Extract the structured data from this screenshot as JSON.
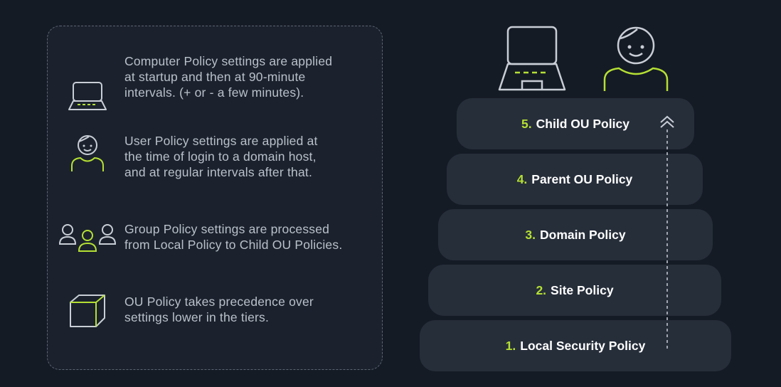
{
  "notes": [
    {
      "icon": "laptop-icon",
      "text_lines": [
        "Computer Policy settings are applied",
        "at startup and then at 90-minute",
        "intervals. (+ or - a few minutes)."
      ]
    },
    {
      "icon": "user-icon",
      "text_lines": [
        "User Policy settings are applied at",
        "the time of login to a domain host,",
        "and at regular intervals after that."
      ]
    },
    {
      "icon": "group-icon",
      "text_lines": [
        "Group Policy settings are processed",
        "from Local Policy to Child OU Policies."
      ]
    },
    {
      "icon": "cube-icon",
      "text_lines": [
        "OU Policy takes precedence over",
        "settings lower in the tiers."
      ]
    }
  ],
  "tiers": [
    {
      "number": "5.",
      "label": "Child OU Policy"
    },
    {
      "number": "4.",
      "label": "Parent OU Policy"
    },
    {
      "number": "3.",
      "label": "Domain Policy"
    },
    {
      "number": "2.",
      "label": "Site Policy"
    },
    {
      "number": "1.",
      "label": "Local Security Policy"
    }
  ],
  "top_icons": [
    "laptop-icon",
    "user-icon"
  ],
  "arrow_icon": "double-chevron-up-icon",
  "colors": {
    "background": "#151b25",
    "panel": "#1b222d",
    "tier": "#262e3a",
    "accent": "#b5e034",
    "icon_stroke": "#c9ced6",
    "text": "#b9c0ca"
  }
}
